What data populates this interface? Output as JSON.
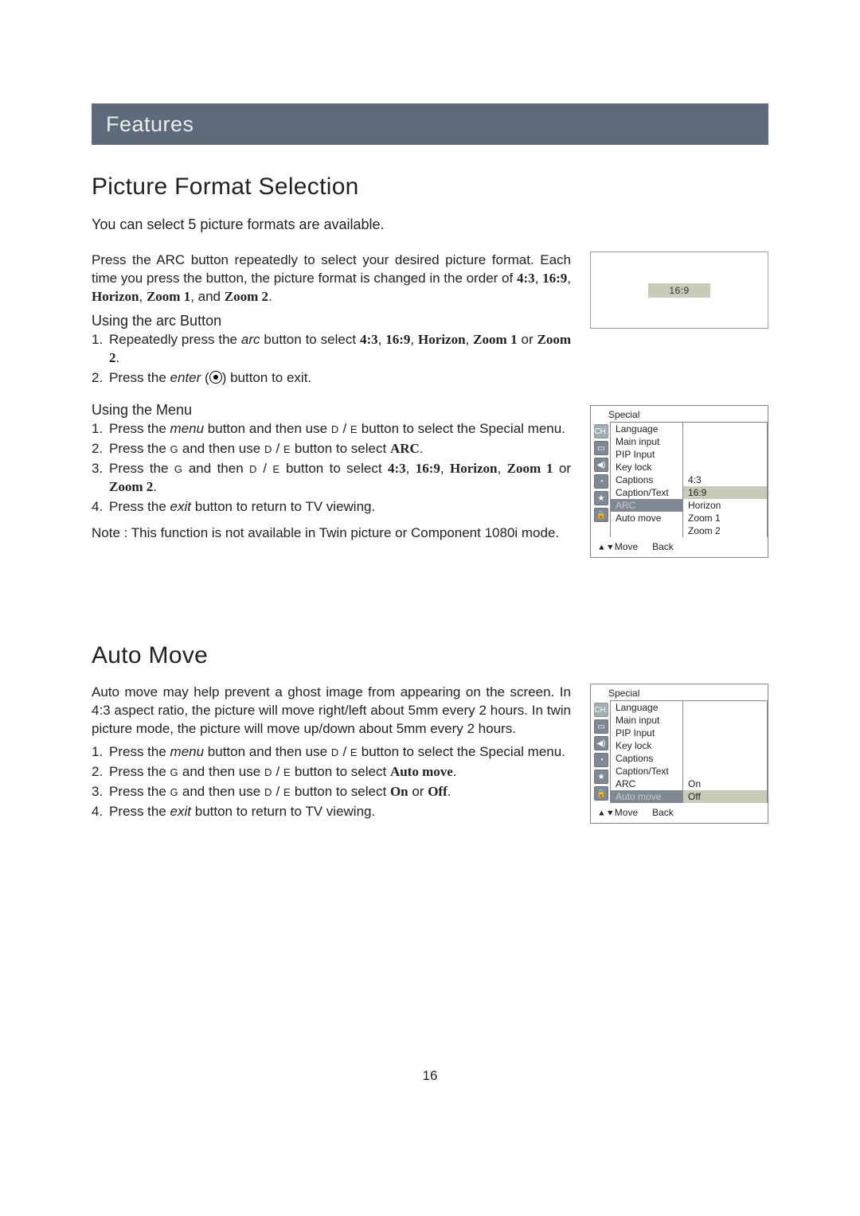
{
  "header": {
    "title": "Features"
  },
  "section1": {
    "title": "Picture Format Selection",
    "intro": "You can select 5 picture formats are available.",
    "para1a": "Press the ARC button repeatedly to select your desired picture format. Each time you press the button, the picture format is changed in the order of ",
    "formats": [
      "4:3",
      "16:9",
      "Horizon",
      "Zoom 1",
      "Zoom 2"
    ],
    "subhead_arc": "Using the arc Button",
    "arc_steps": {
      "s1a": "Repeatedly press the ",
      "s1_arc": "arc",
      "s1b": " button to select ",
      "s1c": " or ",
      "s2a": "Press the ",
      "s2_enter": "enter",
      "s2b": " button to exit."
    },
    "subhead_menu": "Using the Menu",
    "menu_steps": {
      "s1a": "Press the ",
      "s1_menu": "menu",
      "s1b": " button and then use ",
      "s1c": " button to select the Special menu.",
      "s2a": "Press the ",
      "s2b": " and then use ",
      "s2c": " button to select ",
      "s2_arc": "ARC",
      "s3a": "Press the ",
      "s3b": " and then ",
      "s3c": " button to select ",
      "s3d": " or ",
      "s4a": "Press the ",
      "s4_exit": "exit",
      "s4b": " button to return to TV viewing."
    },
    "note": "Note : This function is not available in Twin picture or Component 1080i mode.",
    "preview_label": "16:9",
    "osd": {
      "title": "Special",
      "left": [
        "Language",
        "Main input",
        "PIP Input",
        "Key lock",
        "Captions",
        "Caption/Text",
        "ARC",
        "Auto move"
      ],
      "right": [
        "",
        "",
        "",
        "",
        "4:3",
        "16:9",
        "Horizon",
        "Zoom 1",
        "Zoom 2"
      ],
      "selected_left_index": 6,
      "selected_right_index": 5,
      "footer_move": "Move",
      "footer_back": "Back"
    }
  },
  "section2": {
    "title": "Auto Move",
    "intro": "Auto move may help prevent a ghost image from appearing on the screen. In 4:3 aspect ratio, the picture will move right/left about 5mm every 2 hours. In twin picture mode, the picture will move up/down about 5mm every 2 hours.",
    "steps": {
      "s1a": "Press the ",
      "s1_menu": "menu",
      "s1b": " button and then use ",
      "s1c": " button to select the Special menu.",
      "s2a": "Press the ",
      "s2b": " and then use ",
      "s2c": " button to select ",
      "s2_auto": "Auto move",
      "s3a": "Press the ",
      "s3b": " and then use ",
      "s3c": " button to select ",
      "s3_on": "On",
      "s3_off": "Off",
      "s4a": "Press the ",
      "s4_exit": "exit",
      "s4b": " button to return to TV viewing."
    },
    "osd": {
      "title": "Special",
      "left": [
        "Language",
        "Main input",
        "PIP Input",
        "Key lock",
        "Captions",
        "Caption/Text",
        "ARC",
        "Auto move"
      ],
      "right": [
        "",
        "",
        "",
        "",
        "",
        "",
        "On",
        "Off"
      ],
      "selected_left_index": 7,
      "selected_right_index": 7,
      "footer_move": "Move",
      "footer_back": "Back"
    }
  },
  "glyphs": {
    "D": "D",
    "E": "E",
    "G": "G",
    "sep": " / ",
    "updown": "▲▼"
  },
  "page_number": "16"
}
